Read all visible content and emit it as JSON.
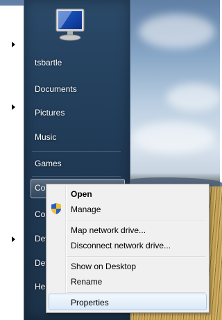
{
  "start_menu": {
    "items": [
      {
        "label": "tsbartle"
      },
      {
        "label": "Documents"
      },
      {
        "label": "Pictures"
      },
      {
        "label": "Music"
      },
      {
        "label": "Games"
      },
      {
        "label": "Co"
      },
      {
        "label": "Co"
      },
      {
        "label": "Dev"
      },
      {
        "label": "Def"
      },
      {
        "label": "Hel"
      }
    ],
    "computer_icon": "computer-monitor-icon"
  },
  "context_menu": {
    "items": [
      {
        "label": "Open",
        "bold": true
      },
      {
        "label": "Manage",
        "icon": "uac-shield-icon"
      },
      {
        "label": "Map network drive..."
      },
      {
        "label": "Disconnect network drive..."
      },
      {
        "label": "Show on Desktop"
      },
      {
        "label": "Rename"
      },
      {
        "label": "Properties",
        "hovered": true
      }
    ]
  },
  "colors": {
    "menu_dark": "#24415e",
    "context_bg": "#f0f0f0",
    "hover_border": "#a8c8e8"
  }
}
